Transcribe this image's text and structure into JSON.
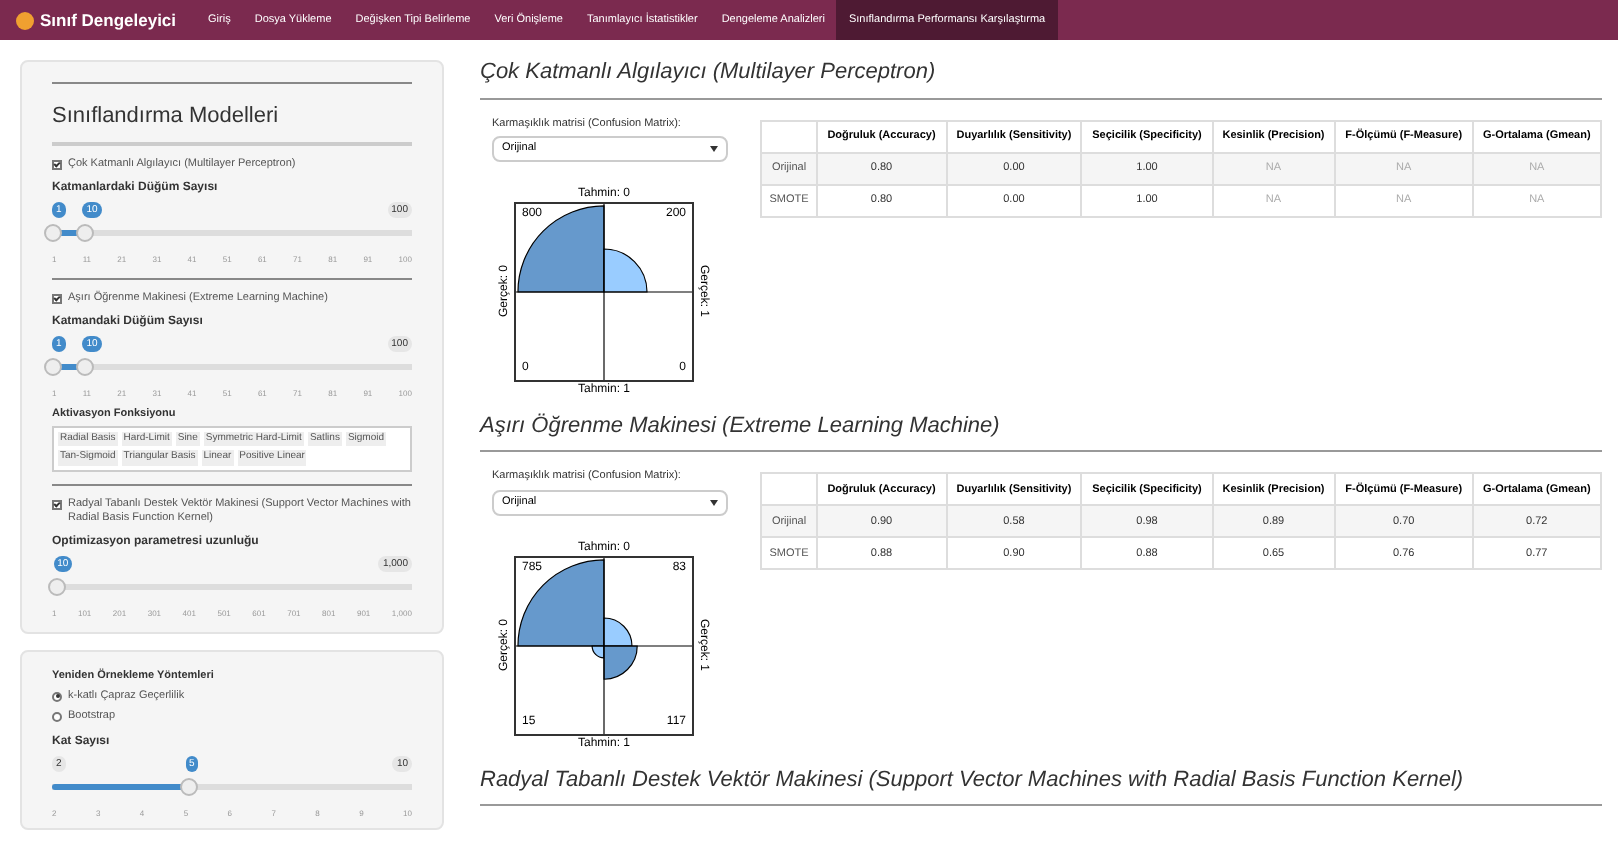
{
  "navbar": {
    "brand": "Sınıf Dengeleyici",
    "tabs": [
      {
        "label": "Giriş",
        "selected": false
      },
      {
        "label": "Dosya Yükleme",
        "selected": false
      },
      {
        "label": "Değişken Tipi Belirleme",
        "selected": false
      },
      {
        "label": "Veri Önişleme",
        "selected": false
      },
      {
        "label": "Tanımlayıcı İstatistikler",
        "selected": false
      },
      {
        "label": "Dengeleme Analizleri",
        "selected": false
      },
      {
        "label": "Sınıflandırma Performansı Karşılaştırma",
        "selected": true
      }
    ]
  },
  "sidebar": {
    "title": "Sınıflandırma Modelleri",
    "models": [
      {
        "kind": "slider",
        "label": "Çok Katmanlı Algılayıcı (Multilayer Perceptron)",
        "checked": true,
        "slider": {
          "label": "Katmanlardaki Düğüm Sayısı",
          "values": [
            "1",
            "10"
          ],
          "max": "100",
          "level": 0.09,
          "ticks": [
            "1",
            "11",
            "21",
            "31",
            "41",
            "51",
            "61",
            "71",
            "81",
            "91",
            "100"
          ]
        }
      },
      {
        "kind": "slider",
        "label": "Aşırı Öğrenme Makinesi (Extreme Learning Machine)",
        "checked": true,
        "slider": {
          "label": "Katmandaki Düğüm Sayısı",
          "values": [
            "1",
            "10"
          ],
          "max": "100",
          "level": 0.09,
          "ticks": [
            "1",
            "11",
            "21",
            "31",
            "41",
            "51",
            "61",
            "71",
            "81",
            "91",
            "100"
          ]
        },
        "activation": {
          "label": "Aktivasyon Fonksiyonu",
          "options": [
            "Radial Basis",
            "Hard-Limit",
            "Sine",
            "Symmetric Hard-Limit",
            "Satlins",
            "Sigmoid",
            "Tan-Sigmoid",
            "Triangular Basis",
            "Linear",
            "Positive Linear"
          ]
        }
      },
      {
        "kind": "slider",
        "label": "Radyal Tabanlı Destek Vektör Makinesi (Support Vector Machines with Radial Basis Function Kernel)",
        "checked": true,
        "slider": {
          "label": "Optimizasyon parametresi uzunluğu",
          "values": [
            "10"
          ],
          "max": "1,000",
          "level": 0.009,
          "ticks": [
            "1",
            "101",
            "201",
            "301",
            "401",
            "501",
            "601",
            "701",
            "801",
            "901",
            "1,000"
          ]
        }
      }
    ],
    "resampling": {
      "label": "Yeniden Örnekleme Yöntemleri",
      "options": [
        {
          "label": "k-katlı Çapraz Geçerlilik",
          "selected": true
        },
        {
          "label": "Bootstrap",
          "selected": false
        }
      ],
      "slider": {
        "label": "Kat Sayısı",
        "values": [
          "5"
        ],
        "min": "2",
        "max": "10",
        "level": 0.375,
        "ticks": [
          "2",
          "3",
          "4",
          "5",
          "6",
          "7",
          "8",
          "9",
          "10"
        ]
      }
    }
  },
  "models": [
    {
      "title": "Çok Katmanlı Algılayıcı (Multilayer Perceptron)",
      "select": {
        "label": "Karmaşıklık matrisi (Confusion Matrix):",
        "value": "Orijinal"
      },
      "matrix": {
        "top": "Tahmin: 0",
        "bottom": "Tahmin: 1",
        "left": "Gerçek: 0",
        "right": "Gerçek: 1",
        "cells": [
          "800",
          "200",
          "0",
          "0"
        ]
      },
      "table": {
        "columns": [
          "Doğruluk (Accuracy)",
          "Duyarlılık (Sensitivity)",
          "Seçicilik (Specificity)",
          "Kesinlik (Precision)",
          "F-Ölçümü (F-Measure)",
          "G-Ortalama (Gmean)"
        ],
        "rows": [
          {
            "name": "Orijinal",
            "cells": [
              {
                "text": "0.80",
                "muted": false
              },
              {
                "text": "0.00",
                "muted": false
              },
              {
                "text": "1.00",
                "muted": false
              },
              {
                "text": "NA",
                "muted": true
              },
              {
                "text": "NA",
                "muted": true
              },
              {
                "text": "NA",
                "muted": true
              }
            ]
          },
          {
            "name": "SMOTE",
            "cells": [
              {
                "text": "0.80",
                "muted": false
              },
              {
                "text": "0.00",
                "muted": false
              },
              {
                "text": "1.00",
                "muted": false
              },
              {
                "text": "NA",
                "muted": true
              },
              {
                "text": "NA",
                "muted": true
              },
              {
                "text": "NA",
                "muted": true
              }
            ]
          }
        ]
      }
    },
    {
      "title": "Aşırı Öğrenme Makinesi (Extreme Learning Machine)",
      "select": {
        "label": "Karmaşıklık matrisi (Confusion Matrix):",
        "value": "Orijinal"
      },
      "matrix": {
        "top": "Tahmin: 0",
        "bottom": "Tahmin: 1",
        "left": "Gerçek: 0",
        "right": "Gerçek: 1",
        "cells": [
          "785",
          "83",
          "15",
          "117"
        ]
      },
      "table": {
        "columns": [
          "Doğruluk (Accuracy)",
          "Duyarlılık (Sensitivity)",
          "Seçicilik (Specificity)",
          "Kesinlik (Precision)",
          "F-Ölçümü (F-Measure)",
          "G-Ortalama (Gmean)"
        ],
        "rows": [
          {
            "name": "Orijinal",
            "cells": [
              {
                "text": "0.90",
                "muted": false
              },
              {
                "text": "0.58",
                "muted": false
              },
              {
                "text": "0.98",
                "muted": false
              },
              {
                "text": "0.89",
                "muted": false
              },
              {
                "text": "0.70",
                "muted": false
              },
              {
                "text": "0.72",
                "muted": false
              }
            ]
          },
          {
            "name": "SMOTE",
            "cells": [
              {
                "text": "0.88",
                "muted": false
              },
              {
                "text": "0.90",
                "muted": false
              },
              {
                "text": "0.88",
                "muted": false
              },
              {
                "text": "0.65",
                "muted": false
              },
              {
                "text": "0.76",
                "muted": false
              },
              {
                "text": "0.77",
                "muted": false
              }
            ]
          }
        ]
      }
    },
    {
      "title": "Radyal Tabanlı Destek Vektör Makinesi (Support Vector Machines with Radial Basis Function Kernel)"
    }
  ]
}
